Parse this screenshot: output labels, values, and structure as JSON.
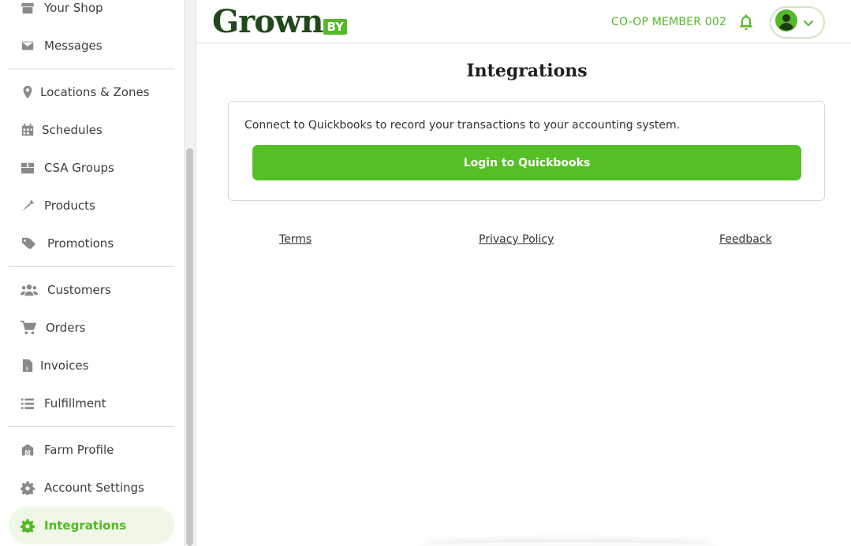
{
  "sidebar": {
    "items": [
      {
        "label": "Your Shop",
        "icon": "shop-icon"
      },
      {
        "label": "Messages",
        "icon": "envelope-icon"
      },
      {
        "label": "Locations & Zones",
        "icon": "map-pin-icon"
      },
      {
        "label": "Schedules",
        "icon": "calendar-icon"
      },
      {
        "label": "CSA Groups",
        "icon": "box-icon"
      },
      {
        "label": "Products",
        "icon": "carrot-icon"
      },
      {
        "label": "Promotions",
        "icon": "tags-icon"
      },
      {
        "label": "Customers",
        "icon": "users-icon"
      },
      {
        "label": "Orders",
        "icon": "cart-icon"
      },
      {
        "label": "Invoices",
        "icon": "invoice-icon"
      },
      {
        "label": "Fulfillment",
        "icon": "list-icon"
      },
      {
        "label": "Farm Profile",
        "icon": "barn-icon"
      },
      {
        "label": "Account Settings",
        "icon": "gear-icon"
      },
      {
        "label": "Integrations",
        "icon": "gear-icon",
        "active": true
      }
    ]
  },
  "header": {
    "logo_word": "Grown",
    "logo_badge": "BY",
    "member_label": "CO-OP MEMBER 002"
  },
  "main": {
    "title": "Integrations",
    "card_text": "Connect to Quickbooks to record your transactions to your accounting system.",
    "button_label": "Login to Quickbooks"
  },
  "footer": {
    "terms": "Terms",
    "privacy": "Privacy Policy",
    "feedback": "Feedback"
  },
  "colors": {
    "brand_green": "#55b826",
    "logo_dark": "#23471c",
    "active_bg": "#eff7e6"
  }
}
